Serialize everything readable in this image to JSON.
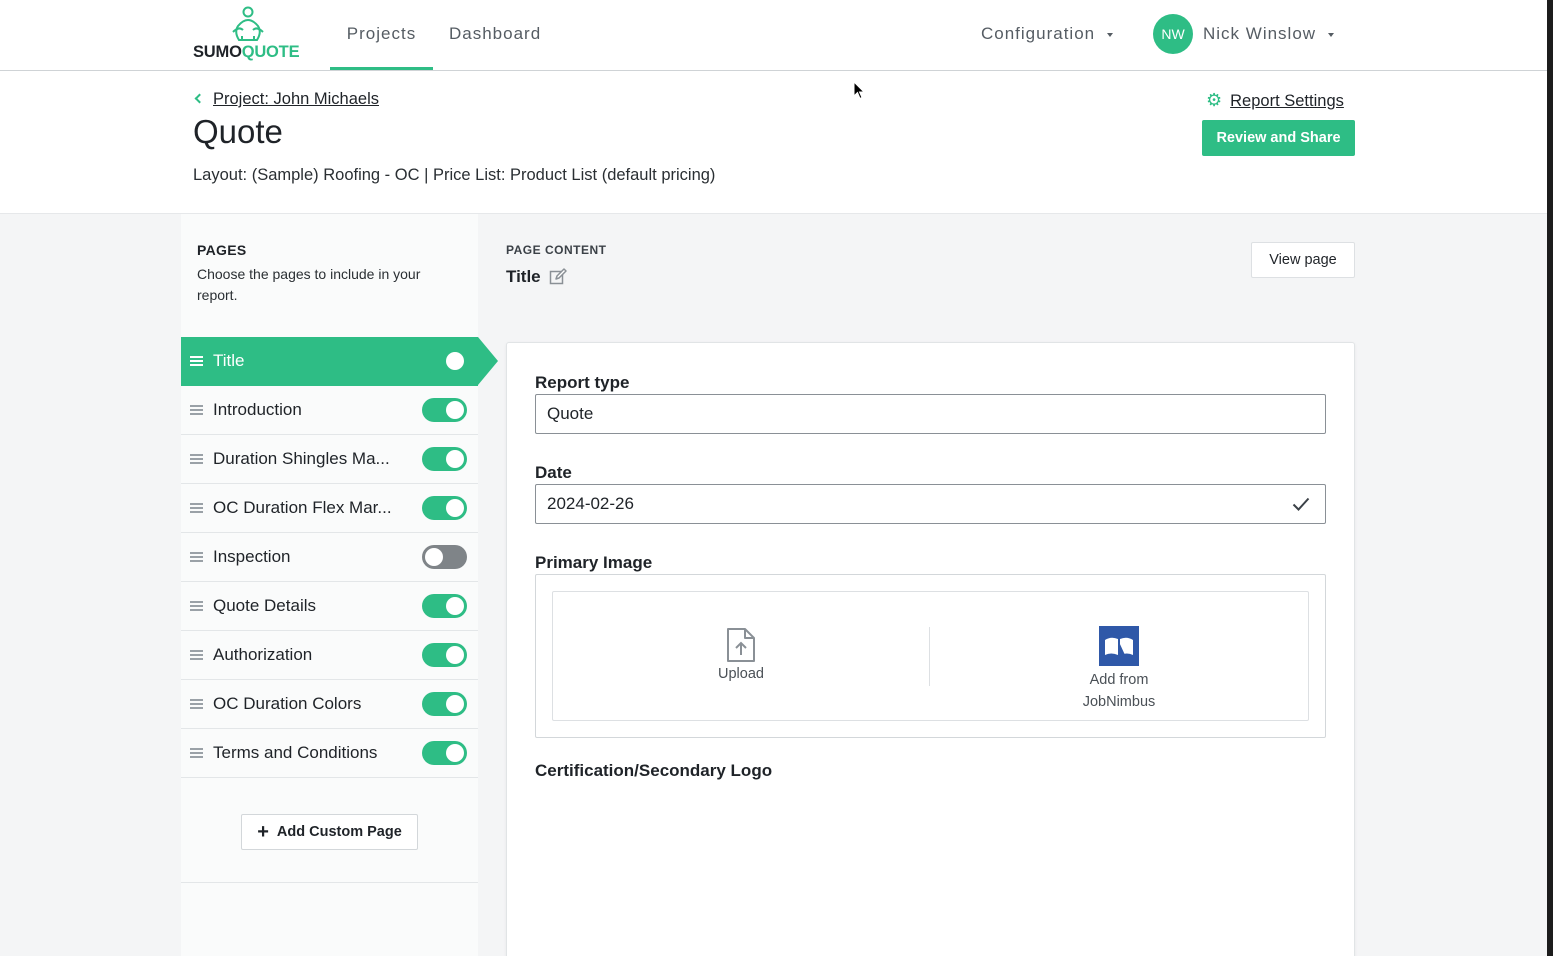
{
  "brand": {
    "name_part1": "SUMO",
    "name_part2": "QUOTE",
    "accent": "#2ebd85"
  },
  "nav": {
    "projects": "Projects",
    "dashboard": "Dashboard",
    "configuration": "Configuration",
    "user_initials": "NW",
    "user_name": "Nick Winslow"
  },
  "header": {
    "back_link": "Project: John Michaels",
    "title": "Quote",
    "layout_line": "Layout: (Sample) Roofing - OC | Price List: Product List (default pricing)",
    "report_settings": "Report Settings",
    "review_button": "Review and Share"
  },
  "sidebar": {
    "title": "PAGES",
    "description": "Choose the pages to include in your report.",
    "pages": [
      {
        "label": "Title",
        "enabled": true,
        "active": true
      },
      {
        "label": "Introduction",
        "enabled": true
      },
      {
        "label": "Duration Shingles Ma...",
        "enabled": true
      },
      {
        "label": "OC Duration Flex Mar...",
        "enabled": true
      },
      {
        "label": "Inspection",
        "enabled": false
      },
      {
        "label": "Quote Details",
        "enabled": true
      },
      {
        "label": "Authorization",
        "enabled": true
      },
      {
        "label": "OC Duration Colors",
        "enabled": true
      },
      {
        "label": "Terms and Conditions",
        "enabled": true
      }
    ],
    "add_button": "Add Custom Page"
  },
  "content": {
    "section_title": "PAGE CONTENT",
    "page_name": "Title",
    "view_button": "View page",
    "report_type_label": "Report type",
    "report_type_value": "Quote",
    "date_label": "Date",
    "date_value": "2024-02-26",
    "primary_image_label": "Primary Image",
    "upload_label": "Upload",
    "jobnimbus_label_line1": "Add from",
    "jobnimbus_label_line2": "JobNimbus",
    "secondary_logo_label": "Certification/Secondary Logo"
  }
}
